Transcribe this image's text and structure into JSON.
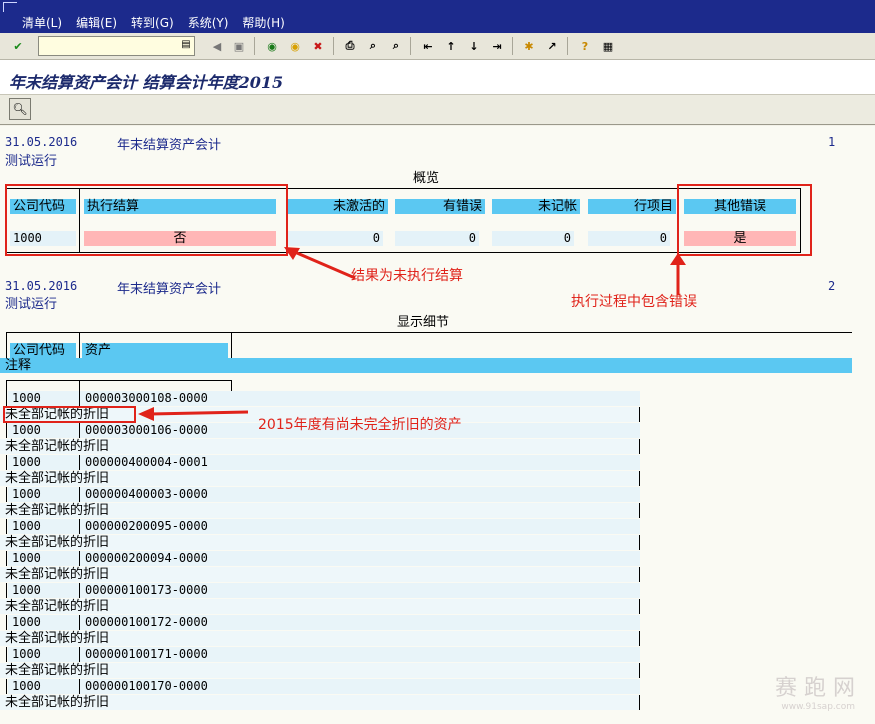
{
  "menu": {
    "items": [
      "清单(L)",
      "编辑(E)",
      "转到(G)",
      "系统(Y)",
      "帮助(H)"
    ]
  },
  "toolbar": {
    "command_value": "",
    "icons": [
      "enter-icon",
      "save-icon",
      "back-icon",
      "exit-icon",
      "cancel-icon",
      "print-icon",
      "find-icon",
      "find-next-icon",
      "first-page-icon",
      "prev-page-icon",
      "next-page-icon",
      "last-page-icon",
      "new-session-icon",
      "shortcut-icon",
      "help-icon",
      "layout-icon"
    ]
  },
  "title": "年末结算资产会计 结算会计年度2015",
  "report": {
    "page1": {
      "date": "31.05.2016",
      "heading": "年末结算资产会计",
      "page_no": "1",
      "run_type": "测试运行",
      "section": "概览",
      "columns": [
        "公司代码",
        "执行结算",
        "未激活的",
        "有错误",
        "未记帐",
        "行项目",
        "其他错误"
      ],
      "row": {
        "company": "1000",
        "executed": "否",
        "inactive": "0",
        "errors": "0",
        "unposted": "0",
        "line_items": "0",
        "other_errors": "是"
      }
    },
    "page2": {
      "date": "31.05.2016",
      "heading": "年末结算资产会计",
      "page_no": "2",
      "run_type": "测试运行",
      "section": "显示细节",
      "columns": [
        "公司代码",
        "资产"
      ],
      "notes_header": "注释",
      "rows": [
        {
          "company": "1000",
          "asset": "000003000108-0000",
          "note": "未全部记帐的折旧"
        },
        {
          "company": "1000",
          "asset": "000003000106-0000",
          "note": "未全部记帐的折旧"
        },
        {
          "company": "1000",
          "asset": "000000400004-0001",
          "note": "未全部记帐的折旧"
        },
        {
          "company": "1000",
          "asset": "000000400003-0000",
          "note": "未全部记帐的折旧"
        },
        {
          "company": "1000",
          "asset": "000000200095-0000",
          "note": "未全部记帐的折旧"
        },
        {
          "company": "1000",
          "asset": "000000200094-0000",
          "note": "未全部记帐的折旧"
        },
        {
          "company": "1000",
          "asset": "000000100173-0000",
          "note": "未全部记帐的折旧"
        },
        {
          "company": "1000",
          "asset": "000000100172-0000",
          "note": "未全部记帐的折旧"
        },
        {
          "company": "1000",
          "asset": "000000100171-0000",
          "note": "未全部记帐的折旧"
        },
        {
          "company": "1000",
          "asset": "000000100170-0000",
          "note": "未全部记帐的折旧"
        }
      ]
    }
  },
  "annotations": {
    "not_executed": "结果为未执行结算",
    "contains_errors": "执行过程中包含错误",
    "undepreciated": "2015年度有尚未完全折旧的资产",
    "color": "#e0231a"
  },
  "watermark": {
    "text": "赛 跑 网",
    "url": "www.91sap.com"
  }
}
